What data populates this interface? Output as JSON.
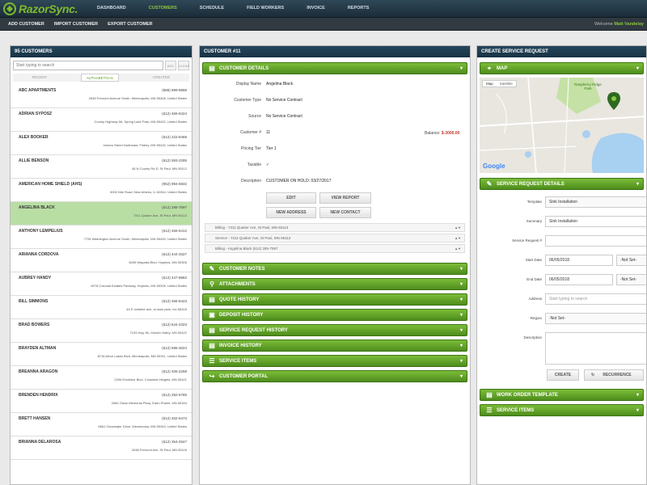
{
  "app": {
    "name": "RazorSync."
  },
  "nav": {
    "items": [
      "DASHBOARD",
      "CUSTOMERS",
      "SCHEDULE",
      "FIELD WORKERS",
      "INVOICE",
      "REPORTS"
    ],
    "active_index": 1
  },
  "subnav": {
    "items": [
      "ADD CUSTOMER",
      "IMPORT CUSTOMER",
      "EXPORT CUSTOMER"
    ]
  },
  "welcome": {
    "prefix": "Welcome",
    "user": "Matt Vandelay"
  },
  "customers": {
    "title": "95 CUSTOMERS",
    "search_placeholder": "Start typing to search",
    "add_label": "ADD",
    "clear_label": "CLEAR",
    "sort_tabs": [
      "RECENT",
      "ALPHABETICAL",
      "CREATED"
    ],
    "sort_active": 1,
    "list": [
      {
        "name": "ABC APARTMENTS",
        "phone": "(888) 999-8888",
        "address": "2638 Fremont Avenue South, Minneapolis, MN 55408, United States"
      },
      {
        "name": "ADRIAN SYPOSZ",
        "phone": "(612) 466-9424",
        "address": "County Highway 56, Spring Lake Park, MN 55432, United States"
      },
      {
        "name": "ALEX BOOKER",
        "phone": "(612) 222-8469",
        "address": "Ironton Street Northeast, Fridley, MN 55432, United States"
      },
      {
        "name": "ALLIE BENSON",
        "phone": "(612) 593-2285",
        "address": "48 N County Rd D, St Paul, MN 55112"
      },
      {
        "name": "AMERICAN HOME SHIELD (AHS)",
        "phone": "(952) 994-6832",
        "address": "9000 Nile Road, New Athens, IL 62264, United States"
      },
      {
        "name": "ANGELINA BLACK",
        "phone": "(612) 285-7597",
        "address": "7311 Quaker Ave, St Paul, MN 55113"
      },
      {
        "name": "ANTHONY LEMPELIUS",
        "phone": "(612) 466-5412",
        "address": "7728 Washington Avenue South, Minneapolis, MN 55439, United States"
      },
      {
        "name": "ARIANNA CORDOVA",
        "phone": "(612) 444-3327",
        "address": "8495 Wayzata Blvd, Hopkins, MN 55305"
      },
      {
        "name": "AUBREY HANDY",
        "phone": "(612) 447-8882",
        "address": "8278 Colonial Estates Parkway, Hopkins, MN 55305, United States"
      },
      {
        "name": "BILL SIMMONS",
        "phone": "(612) 466-8423",
        "address": "45 E cellarfor ave, st louis park, mn 55416"
      },
      {
        "name": "BRAD BOWERS",
        "phone": "(612) 644-2323",
        "address": "7153 Hwy 96, Golden Valley, MN 55422"
      },
      {
        "name": "BRAYDEN ALTMAN",
        "phone": "(612) 585-3024",
        "address": "8718 Arbor Lakes Blvd, Minneapolis, MN 55311, United States"
      },
      {
        "name": "BREANNA ARAGON",
        "phone": "(612) 406-2268",
        "address": "2206 Excelsior Blvd, Columbia Heights, MN 55421"
      },
      {
        "name": "BRENDEN HENDRIX",
        "phone": "(612) 282-8785",
        "address": "2084 Olson Memorial Pkwy, Eden Prairie, MN 55344"
      },
      {
        "name": "BRETT HANSEN",
        "phone": "(612) 402-6473",
        "address": "6661 Clearwater Drive, Minnetonka, MN 55343, United States"
      },
      {
        "name": "BRIANNA DELAROSA",
        "phone": "(612) 354-2547",
        "address": "2638 Fremont Ave, St Paul, MN 55116"
      }
    ],
    "selected_index": 5
  },
  "customer": {
    "title": "CUSTOMER #11",
    "details_bar": "CUSTOMER DETAILS",
    "balance_label": "Balance:",
    "balance_value": "$-3000.00",
    "fields": [
      {
        "label": "Display Name",
        "value": "Angelina Black"
      },
      {
        "label": "Customer Type",
        "value": "No Service Contract"
      },
      {
        "label": "Source",
        "value": "No Service Contract"
      },
      {
        "label": "Customer #",
        "value": "11"
      },
      {
        "label": "Pricing Tier",
        "value": "Tier 1"
      },
      {
        "label": "Taxable",
        "value": "✓"
      },
      {
        "label": "Description",
        "value": "CUSTOMER ON HOLD: 03/27/2017"
      }
    ],
    "buttons": {
      "edit": "EDIT",
      "view_report": "VIEW REPORT",
      "new_address": "NEW ADDRESS",
      "new_contact": "NEW CONTACT"
    },
    "addresses": [
      "Billing - 7311 Quaker Ave, St Paul, MN 55113",
      "Service - 7311 Quaker Ave, St Paul, MN 55113",
      "Billing - Angelina Black (612) 285-7597"
    ],
    "sections": [
      "CUSTOMER NOTES",
      "ATTACHMENTS",
      "QUOTE HISTORY",
      "DEPOSIT HISTORY",
      "SERVICE REQUEST HISTORY",
      "INVOICE HISTORY",
      "SERVICE ITEMS",
      "CUSTOMER PORTAL"
    ]
  },
  "service": {
    "title": "CREATE SERVICE REQUEST",
    "map_bar": "MAP",
    "map": {
      "btn_map": "Map",
      "btn_sat": "Satellite",
      "park_label": "Raspberry Ridge Park",
      "google": "Google"
    },
    "details_bar": "SERVICE REQUEST DETAILS",
    "form": {
      "template_label": "Template",
      "template_value": "Sink Installation",
      "summary_label": "Summary",
      "summary_value": "Sink Installation",
      "request_label": "Service Request #",
      "request_value": "",
      "start_label": "Start Date",
      "start_value": "06/05/2018",
      "start_time": "-Not Set-",
      "end_label": "End Date",
      "end_value": "06/05/2018",
      "end_time": "-Not Set-",
      "address_label": "Address",
      "address_placeholder": "Start typing to search",
      "region_label": "Region",
      "region_value": "-Not Set-",
      "description_label": "Description"
    },
    "buttons": {
      "create": "CREATE",
      "recurrence": "RECURRENCE"
    },
    "work_order_bar": "WORK ORDER TEMPLATE",
    "service_items_bar": "SERVICE ITEMS"
  },
  "colors": {
    "accent": "#6aaa2b",
    "header": "#1f3646",
    "selected_row": "#b9dea4",
    "balance": "#c0392b"
  }
}
